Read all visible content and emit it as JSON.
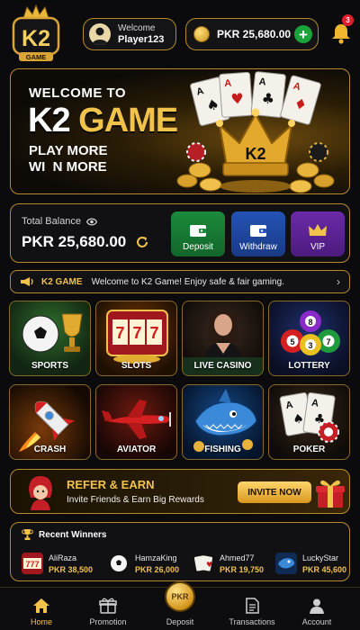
{
  "header": {
    "logo_text": "K2",
    "logo_sub": "GAME",
    "welcome_label": "Welcome",
    "username": "Player123",
    "balance": "PKR 25,680.00",
    "notification_count": "3"
  },
  "banner": {
    "line1": "WELCOME TO",
    "line2_a": "K2 ",
    "line2_b": "GAME",
    "line3": "PLAY MORE",
    "line4": "WI  N MORE",
    "crown_text": "K2"
  },
  "balance_card": {
    "label": "Total Balance",
    "value": "PKR 25,680.00",
    "actions": [
      {
        "label": "Deposit",
        "color": "#1c8a3b"
      },
      {
        "label": "Withdraw",
        "color": "#2453b6"
      },
      {
        "label": "VIP",
        "color": "#6b2aa8"
      }
    ]
  },
  "ticker": {
    "title": "K2 GAME",
    "message": "Welcome to K2 Game! Enjoy safe & fair gaming."
  },
  "games": [
    {
      "label": "SPORTS",
      "icon": "soccer-ball-trophy"
    },
    {
      "label": "SLOTS",
      "icon": "slot-machine-777"
    },
    {
      "label": "LIVE CASINO",
      "icon": "live-dealer"
    },
    {
      "label": "LOTTERY",
      "icon": "lottery-balls"
    },
    {
      "label": "CRASH",
      "icon": "rocket"
    },
    {
      "label": "AVIATOR",
      "icon": "airplane"
    },
    {
      "label": "FISHING",
      "icon": "shark"
    },
    {
      "label": "POKER",
      "icon": "playing-cards"
    }
  ],
  "refer": {
    "title": "REFER & EARN",
    "subtitle": "Invite Friends & Earn Big Rewards",
    "button": "INVITE NOW"
  },
  "winners": {
    "title": "Recent Winners",
    "items": [
      {
        "name": "AliRaza",
        "amount": "PKR 38,500",
        "icon": "slots-thumb"
      },
      {
        "name": "HamzaKing",
        "amount": "PKR 26,000",
        "icon": "soccer-thumb"
      },
      {
        "name": "Ahmed77",
        "amount": "PKR 19,750",
        "icon": "cards-thumb"
      },
      {
        "name": "LuckyStar",
        "amount": "PKR 45,600",
        "icon": "fishing-thumb"
      }
    ]
  },
  "nav": {
    "items": [
      {
        "label": "Home",
        "active": true
      },
      {
        "label": "Promotion",
        "active": false
      },
      {
        "label": "Deposit",
        "active": false
      },
      {
        "label": "Transactions",
        "active": false
      },
      {
        "label": "Account",
        "active": false
      }
    ],
    "fab_text": "PKR"
  },
  "colors": {
    "gold": "#f1c34a",
    "border_gold": "#b68a2c",
    "background": "#0b0b0d",
    "green": "#19a33a",
    "badge_red": "#e01f2b"
  }
}
